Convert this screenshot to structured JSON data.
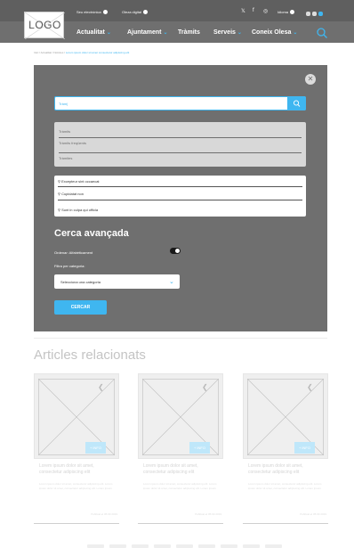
{
  "header": {
    "logo": "LOGO",
    "utility": [
      {
        "label": "Seu electrònica",
        "icon": "globe-icon"
      },
      {
        "label": "Oleza digital",
        "icon": "globe-icon"
      }
    ],
    "social": [
      "twitter-icon",
      "facebook-icon",
      "instagram-icon"
    ],
    "account": {
      "label": "Idioma",
      "icon": "user-icon"
    },
    "languages": [
      "CA",
      "ES",
      "EN"
    ],
    "nav": [
      {
        "label": "Actualitat",
        "has_dropdown": true
      },
      {
        "label": "Ajuntament",
        "has_dropdown": true
      },
      {
        "label": "Tràmits",
        "has_dropdown": false
      },
      {
        "label": "Serveis",
        "has_dropdown": true
      },
      {
        "label": "Coneix Olesa",
        "has_dropdown": true
      }
    ],
    "search_icon": "search-icon"
  },
  "breadcrumb": {
    "path": "Inici / Actualitat / Notícies /",
    "current": "Lorem ipsum dolor sit amet consectetur adipiscing elit"
  },
  "search_modal": {
    "query": "Tràm|",
    "quick_links": [
      "Tràmits",
      "Tràmits freqüents",
      "Tràmites"
    ],
    "suggestions": [
      "Excepteur sint occaecat",
      "Cupidatat non",
      "Sunt in culpa qui officia"
    ],
    "advanced_title": "Cerca avançada",
    "alpha_label": "Ordenar: Alfabèticament",
    "alpha_on": true,
    "category_label": "Filtra per categoria:",
    "category_selected": "Selecciona una categoria",
    "submit_label": "CERCAR"
  },
  "related": {
    "title": "Articles relacionats",
    "cards": [
      {
        "tag": "+ INFO",
        "title": "Lorem ipsum dolor sit amet, consectetur adipiscing elit",
        "body": "Lorem ipsum dolor sit amet, consectetur adipiscing elit. Lorem ipsum dolor sit amet, consectetur adipiscing elit. Lorem ipsum",
        "date": "Publicat el 05.03.2019"
      },
      {
        "tag": "+ INFO",
        "title": "Lorem ipsum dolor sit amet, consectetur adipiscing elit",
        "body": "Lorem ipsum dolor sit amet, consectetur adipiscing elit. Lorem ipsum dolor sit amet, consectetur adipiscing elit. Lorem ipsum",
        "date": "Publicat el 05.03.2019"
      },
      {
        "tag": "+ INFO",
        "title": "Lorem ipsum dolor sit amet, consectetur adipiscing elit",
        "body": "Lorem ipsum dolor sit amet, consectetur adipiscing elit. Lorem ipsum dolor sit amet, consectetur adipiscing elit. Lorem ipsum",
        "date": "Publicat el 05.03.2019"
      }
    ]
  },
  "colors": {
    "accent": "#3fb6f0",
    "overlay": "#6f6f6f",
    "header": "#6f6f6f"
  }
}
